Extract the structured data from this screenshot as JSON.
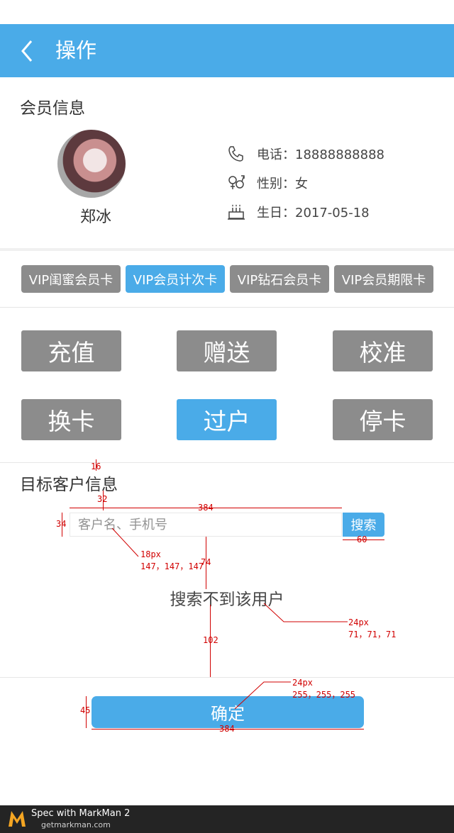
{
  "header": {
    "title": "操作",
    "back_icon": "chevron-left-icon",
    "color": "#4aabe8"
  },
  "member": {
    "section_title": "会员信息",
    "name": "郑冰",
    "phone": "电话：18888888888",
    "gender": "性别：女",
    "birthday": "生日：2017-05-18"
  },
  "card_tabs": [
    "VIP闺蜜会员卡",
    "VIP会员计次卡",
    "VIP钻石会员卡",
    "VIP会员期限卡"
  ],
  "card_tab_active": 1,
  "operations": [
    "充值",
    "赠送",
    "校准",
    "换卡",
    "过户",
    "停卡"
  ],
  "operation_active": 4,
  "target": {
    "section_title": "目标客户信息",
    "search_placeholder": "客户名、手机号",
    "search_button": "搜索",
    "empty_message": "搜索不到该用户"
  },
  "confirm_button": "确定",
  "annotations": {
    "a16": "16",
    "a32": "32",
    "a384_top": "384",
    "a34": "34",
    "a60": "60",
    "a74": "74",
    "a102": "102",
    "a45": "45",
    "a384_bottom": "384",
    "spec_input_size": "18px",
    "spec_input_color": "147，147，147",
    "spec_msg_size": "24px",
    "spec_msg_color": "71，71，71",
    "spec_btn_size": "24px",
    "spec_btn_color": "255，255，255"
  },
  "footer": {
    "brand": "Spec with MarkMan 2",
    "site": "getmarkman.com"
  }
}
